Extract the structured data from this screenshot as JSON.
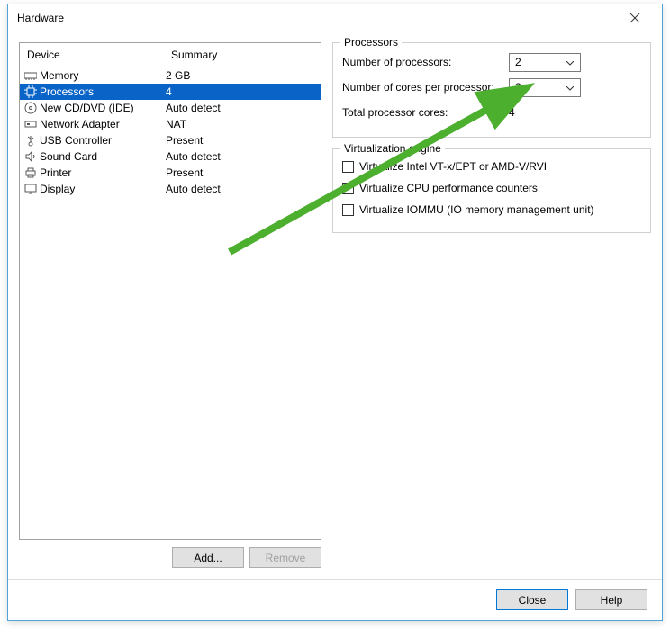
{
  "window": {
    "title": "Hardware"
  },
  "device_list": {
    "header_device": "Device",
    "header_summary": "Summary",
    "rows": [
      {
        "icon": "memory-icon",
        "name": "Memory",
        "summary": "2 GB",
        "selected": false
      },
      {
        "icon": "cpu-icon",
        "name": "Processors",
        "summary": "4",
        "selected": true
      },
      {
        "icon": "disc-icon",
        "name": "New CD/DVD (IDE)",
        "summary": "Auto detect",
        "selected": false
      },
      {
        "icon": "network-icon",
        "name": "Network Adapter",
        "summary": "NAT",
        "selected": false
      },
      {
        "icon": "usb-icon",
        "name": "USB Controller",
        "summary": "Present",
        "selected": false
      },
      {
        "icon": "sound-icon",
        "name": "Sound Card",
        "summary": "Auto detect",
        "selected": false
      },
      {
        "icon": "printer-icon",
        "name": "Printer",
        "summary": "Present",
        "selected": false
      },
      {
        "icon": "display-icon",
        "name": "Display",
        "summary": "Auto detect",
        "selected": false
      }
    ],
    "add_button": "Add...",
    "remove_button": "Remove"
  },
  "processors_group": {
    "title": "Processors",
    "num_processors_label": "Number of processors:",
    "num_processors_value": "2",
    "cores_per_processor_label": "Number of cores per processor:",
    "cores_per_processor_value": "2",
    "total_cores_label": "Total processor cores:",
    "total_cores_value": "4"
  },
  "virt_group": {
    "title": "Virtualization engine",
    "opt1": "Virtualize Intel VT-x/EPT or AMD-V/RVI",
    "opt2": "Virtualize CPU performance counters",
    "opt3": "Virtualize IOMMU (IO memory management unit)"
  },
  "bottom": {
    "close": "Close",
    "help": "Help"
  }
}
